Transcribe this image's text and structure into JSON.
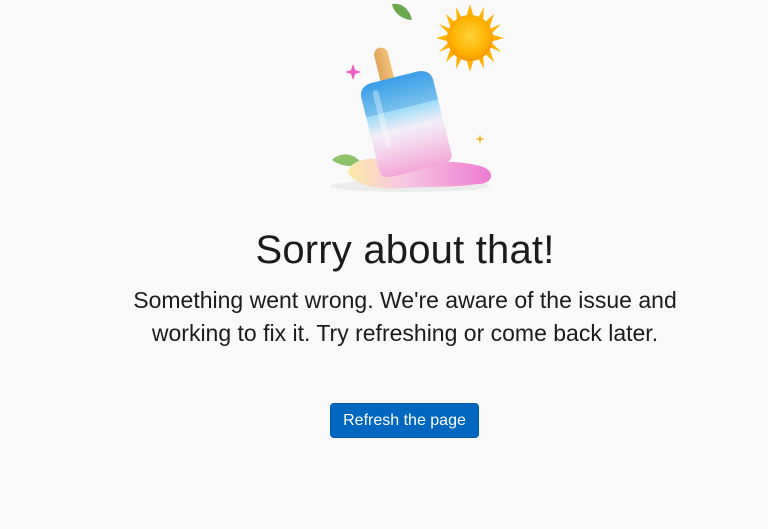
{
  "error": {
    "heading": "Sorry about that!",
    "message": "Something went wrong. We're aware of the issue and working to fix it. Try refreshing or come back later.",
    "refresh_label": "Refresh the page"
  },
  "illustration": {
    "icon": "melting-popsicle-sun-illustration"
  },
  "colors": {
    "background": "#f9f9f9",
    "accent": "#0067c0",
    "text": "#1b1b1b"
  }
}
